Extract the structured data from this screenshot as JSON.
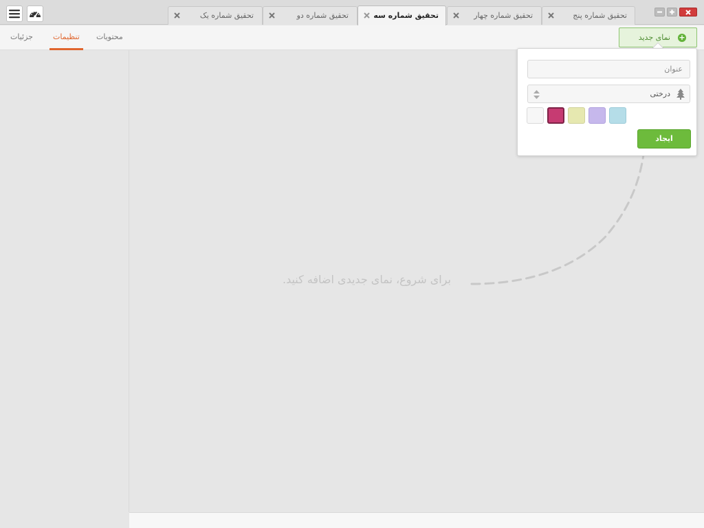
{
  "window": {
    "minimize_icon": "minus-icon",
    "maximize_icon": "plus-icon",
    "close_icon": "close-icon"
  },
  "header": {
    "menu_icon": "hamburger-icon",
    "dashboard_icon": "gauge-icon"
  },
  "tabs": [
    {
      "label": "تحقیق شماره پنج",
      "active": false
    },
    {
      "label": "تحقیق شماره چهار",
      "active": false
    },
    {
      "label": "تحقیق شماره سه",
      "active": true
    },
    {
      "label": "تحقیق شماره دو",
      "active": false
    },
    {
      "label": "تحقیق شماره یک",
      "active": false
    }
  ],
  "toolbar": {
    "new_view_label": "نمای جدید",
    "subtabs": [
      {
        "label": "محتویات",
        "active": false
      },
      {
        "label": "تنظیمات",
        "active": true
      },
      {
        "label": "جزئیات",
        "active": false
      }
    ]
  },
  "popover": {
    "title_placeholder": "عنوان",
    "title_value": "",
    "view_type": "درختی",
    "view_type_icon": "tree-icon",
    "swatches": [
      "#b5dde8",
      "#c6b8ec",
      "#e6e8b0",
      "#c63b72",
      "#f7f7f7"
    ],
    "selected_swatch": 3,
    "create_label": "ایجاد"
  },
  "main": {
    "empty_message": "برای شروع، نمای جدیدی اضافه کنید."
  },
  "colors": {
    "accent": "#e0652d",
    "primary_green": "#6dbb3c",
    "close_red": "#d13c3c"
  }
}
